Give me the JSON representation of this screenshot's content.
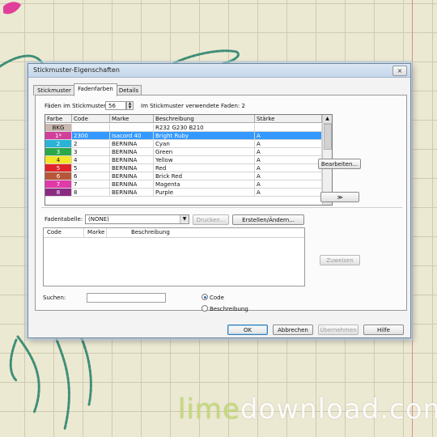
{
  "watermark": {
    "part1": "lime",
    "part2": "download.com"
  },
  "dialog": {
    "title": "Stickmuster-Eigenschaften",
    "close": "×",
    "tabs": [
      {
        "label": "Stickmuster",
        "active": false
      },
      {
        "label": "Fadenfarben",
        "active": true
      },
      {
        "label": "Details",
        "active": false
      }
    ],
    "threads_label": "Fäden im Stickmuster:",
    "threads_value": "56",
    "used_label": "Im Stickmuster verwendete Faden: 2",
    "columns": [
      "Farbe",
      "Code",
      "Marke",
      "Beschreibung",
      "Stärke"
    ],
    "rows": [
      {
        "farbe": "BKG",
        "color": "#c8b8b0",
        "code": "",
        "marke": "",
        "beschreibung": "R232 G230 B210",
        "staerke": ""
      },
      {
        "farbe": "1*",
        "color": "#d0409a",
        "code": "2300",
        "marke": "Isacord 40",
        "beschreibung": "Bright Ruby",
        "staerke": "A"
      },
      {
        "farbe": "2",
        "color": "#2ab3d6",
        "code": "2",
        "marke": "BERNINA",
        "beschreibung": "Cyan",
        "staerke": "A"
      },
      {
        "farbe": "3",
        "color": "#2aa84a",
        "code": "3",
        "marke": "BERNINA",
        "beschreibung": "Green",
        "staerke": "A"
      },
      {
        "farbe": "4",
        "color": "#f2e52a",
        "code": "4",
        "marke": "BERNINA",
        "beschreibung": "Yellow",
        "staerke": "A"
      },
      {
        "farbe": "5",
        "color": "#e0242a",
        "code": "5",
        "marke": "BERNINA",
        "beschreibung": "Red",
        "staerke": "A"
      },
      {
        "farbe": "6",
        "color": "#b8563a",
        "code": "6",
        "marke": "BERNINA",
        "beschreibung": "Brick Red",
        "staerke": "A"
      },
      {
        "farbe": "7",
        "color": "#e03aa8",
        "code": "7",
        "marke": "BERNINA",
        "beschreibung": "Magenta",
        "staerke": "A"
      },
      {
        "farbe": "8",
        "color": "#8a2a82",
        "code": "8",
        "marke": "BERNINA",
        "beschreibung": "Purple",
        "staerke": "A"
      }
    ],
    "selected_row": 1,
    "edit_button": "Bearbeiten...",
    "expand_button": "≫",
    "threadtable_label": "Fadentabelle:",
    "threadtable_value": "(NONE)",
    "print_button": "Drucken...",
    "create_button": "Erstellen/Ändern...",
    "list2_columns": [
      "Code",
      "Marke",
      "Beschreibung"
    ],
    "assign_button": "Zuweisen",
    "search_label": "Suchen:",
    "search_value": "",
    "radio_code": "Code",
    "radio_desc": "Beschreibung",
    "radio_selected": "code",
    "ok": "OK",
    "cancel": "Abbrechen",
    "apply": "Übernehmen",
    "help": "Hilfe"
  },
  "colors": {
    "stitch": "#3f8f78",
    "pink": "#e0409a",
    "accent": "#3399ff"
  }
}
